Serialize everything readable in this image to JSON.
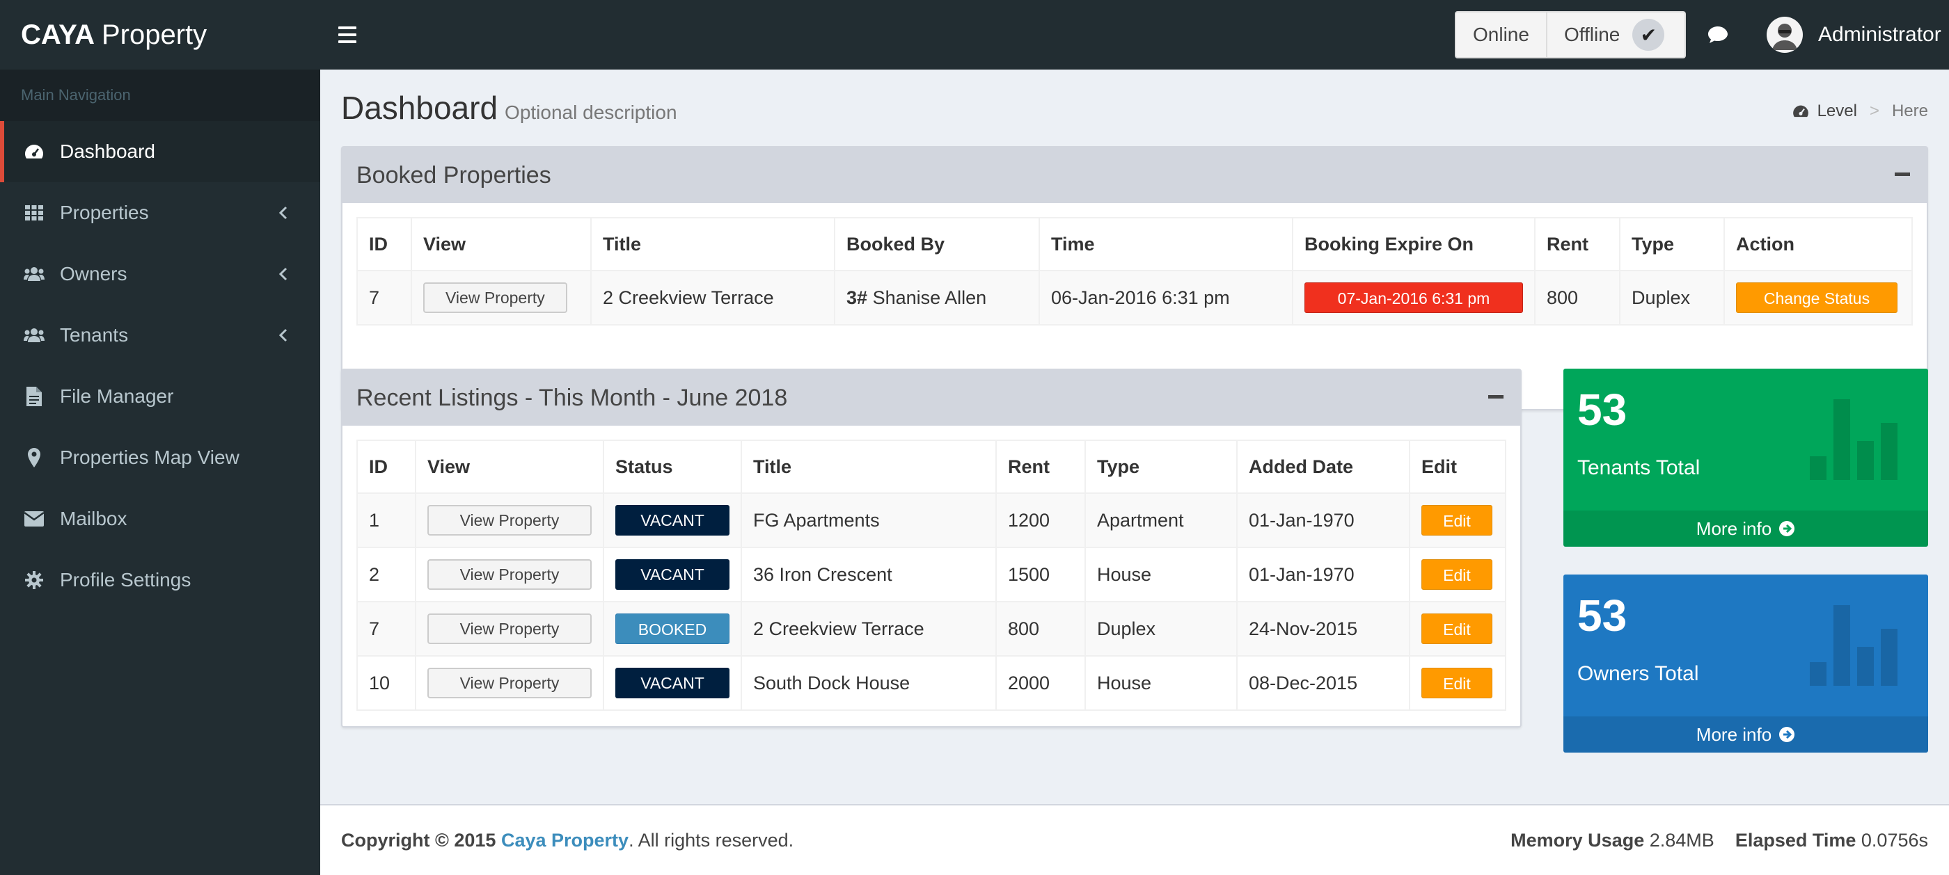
{
  "header": {
    "logo_bold": "CAYA",
    "logo_rest": "Property",
    "online_label": "Online",
    "offline_label": "Offline",
    "user_name": "Administrator"
  },
  "sidebar": {
    "header": "Main Navigation",
    "items": [
      {
        "label": "Dashboard",
        "icon": "dashboard-icon",
        "active": true
      },
      {
        "label": "Properties",
        "icon": "grid-icon",
        "has_children": true
      },
      {
        "label": "Owners",
        "icon": "users-icon",
        "has_children": true
      },
      {
        "label": "Tenants",
        "icon": "users-icon",
        "has_children": true
      },
      {
        "label": "File Manager",
        "icon": "file-icon"
      },
      {
        "label": "Properties Map View",
        "icon": "map-marker-icon"
      },
      {
        "label": "Mailbox",
        "icon": "envelope-icon"
      },
      {
        "label": "Profile Settings",
        "icon": "gear-icon"
      }
    ]
  },
  "page": {
    "title": "Dashboard",
    "description": "Optional description",
    "breadcrumb_level": "Level",
    "breadcrumb_sep": ">",
    "breadcrumb_current": "Here"
  },
  "booked": {
    "title": "Booked Properties",
    "columns": [
      "ID",
      "View",
      "Title",
      "Booked By",
      "Time",
      "Booking Expire On",
      "Rent",
      "Type",
      "Action"
    ],
    "row": {
      "id": "7",
      "view": "View Property",
      "title": "2 Creekview Terrace",
      "booked_by_prefix": "3#",
      "booked_by": "Shanise Allen",
      "time": "06-Jan-2016 6:31 pm",
      "expire": "07-Jan-2016 6:31 pm",
      "rent": "800",
      "type": "Duplex",
      "action": "Change Status"
    }
  },
  "recent": {
    "title": "Recent Listings - This Month - June 2018",
    "columns": [
      "ID",
      "View",
      "Status",
      "Title",
      "Rent",
      "Type",
      "Added Date",
      "Edit"
    ],
    "rows": [
      {
        "id": "1",
        "view": "View Property",
        "status": "VACANT",
        "title": "FG Apartments",
        "rent": "1200",
        "type": "Apartment",
        "added": "01-Jan-1970",
        "edit": "Edit"
      },
      {
        "id": "2",
        "view": "View Property",
        "status": "VACANT",
        "title": "36 Iron Crescent",
        "rent": "1500",
        "type": "House",
        "added": "01-Jan-1970",
        "edit": "Edit"
      },
      {
        "id": "7",
        "view": "View Property",
        "status": "BOOKED",
        "title": "2 Creekview Terrace",
        "rent": "800",
        "type": "Duplex",
        "added": "24-Nov-2015",
        "edit": "Edit"
      },
      {
        "id": "10",
        "view": "View Property",
        "status": "VACANT",
        "title": "South Dock House",
        "rent": "2000",
        "type": "House",
        "added": "08-Dec-2015",
        "edit": "Edit"
      }
    ]
  },
  "stats": {
    "tenants": {
      "value": "53",
      "label": "Tenants Total",
      "more": "More info",
      "color": "#00a65a"
    },
    "owners": {
      "value": "53",
      "label": "Owners Total",
      "more": "More info",
      "color": "#1e78c2"
    }
  },
  "footer": {
    "copyright": "Copyright © 2015",
    "company": "Caya Property",
    "rights": ". All rights reserved.",
    "memory_label": "Memory Usage",
    "memory_value": "2.84MB",
    "elapsed_label": "Elapsed Time",
    "elapsed_value": "0.0756s"
  },
  "colors": {
    "sidebar_bg": "#222d32",
    "active_border": "#dd4b39",
    "vacant": "#001f3f",
    "booked": "#3c8dbc",
    "expire_red": "#f0301e",
    "warning": "#ff9a00",
    "link": "#3c8dbc"
  }
}
